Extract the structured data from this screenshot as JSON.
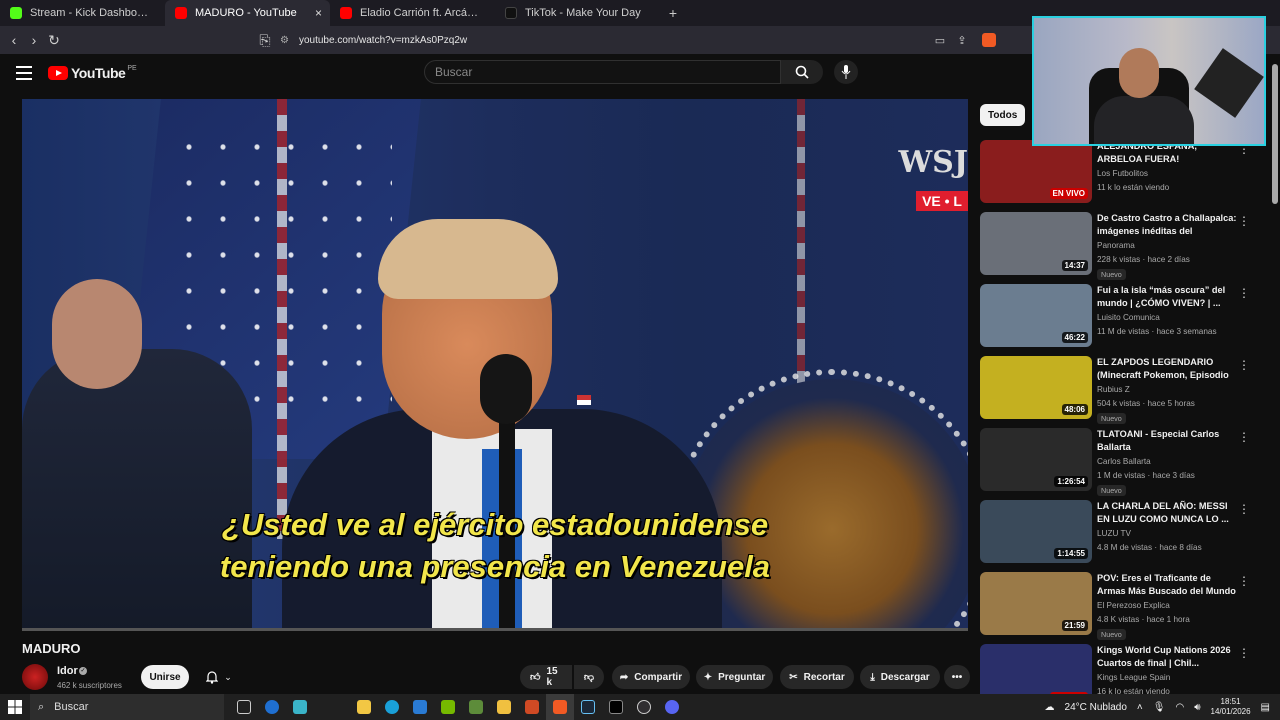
{
  "browser": {
    "tabs": [
      {
        "label": "Stream - Kick Dashboard",
        "favicon_color": "#53fc18"
      },
      {
        "label": "MADURO - YouTube",
        "favicon_color": "#ff0000",
        "close": "×"
      },
      {
        "label": "Eladio Carrión ft. Arcángel, De La Gh",
        "favicon_color": "#ff0000"
      },
      {
        "label": "TikTok - Make Your Day",
        "favicon_color": "#111111"
      }
    ],
    "new_tab": "+",
    "url": "youtube.com/watch?v=mzkAs0Pzq2w"
  },
  "youtube": {
    "logo": "YouTube",
    "country": "PE",
    "search_placeholder": "Buscar",
    "video": {
      "wsj": "WSJ",
      "live_tag": "VE • L",
      "subtitle_line1": "¿Usted ve al ejército estadounidense",
      "subtitle_line2": "teniendo una presencia en Venezuela",
      "title": "MADURO"
    },
    "channel": {
      "name": "Idor",
      "subs": "462 k suscriptores",
      "join": "Unirse"
    },
    "actions": {
      "likes": "15 k",
      "share": "Compartir",
      "ask": "Preguntar",
      "clip": "Recortar",
      "download": "Descargar"
    },
    "chips": {
      "all": "Todos"
    },
    "recommendations": [
      {
        "title": "ALEJANDRO ESPAÑA, ARBELOA FUERA!",
        "channel": "Los Futbolitos",
        "meta": "11 k lo están viendo",
        "badge": "EN VIVO",
        "thumb": "#8a1d1d",
        "new": ""
      },
      {
        "title": "De Castro Castro a Challapalca: imágenes inéditas del traslado...",
        "channel": "Panorama",
        "meta": "228 k vistas · hace 2 días",
        "badge": "14:37",
        "thumb": "#6a6f78",
        "new": "Nuevo"
      },
      {
        "title": "Fui a la isla “más oscura” del mundo | ¿CÓMO VIVEN? | ...",
        "channel": "Luisito Comunica",
        "meta": "11 M de vistas · hace 3 semanas",
        "badge": "46:22",
        "thumb": "#6b7d90",
        "new": ""
      },
      {
        "title": "EL ZAPDOS LEGENDARIO (Minecraft Pokemon, Episodio ...",
        "channel": "Rubius Z",
        "meta": "504 k vistas · hace 5 horas",
        "badge": "48:06",
        "thumb": "#c4b020",
        "new": "Nuevo"
      },
      {
        "title": "TLATOANI - Especial Carlos Ballarta",
        "channel": "Carlos Ballarta",
        "meta": "1 M de vistas · hace 3 días",
        "badge": "1:26:54",
        "thumb": "#2a2a2a",
        "new": "Nuevo"
      },
      {
        "title": "LA CHARLA DEL AÑO: MESSI EN LUZU COMO NUNCA LO ...",
        "channel": "LUZU TV",
        "meta": "4.8 M de vistas · hace 8 días",
        "badge": "1:14:55",
        "thumb": "#3a4a5a",
        "new": ""
      },
      {
        "title": "POV: Eres el Traficante de Armas Más Buscado del Mundo",
        "channel": "El Perezoso Explica",
        "meta": "4.8 K vistas · hace 1 hora",
        "badge": "21:59",
        "thumb": "#9a7a48",
        "new": "Nuevo"
      },
      {
        "title": "Kings World Cup Nations 2026 Cuartos de final | Chil...",
        "channel": "Kings League Spain",
        "meta": "16 k lo están viendo",
        "badge": "EN VIVO",
        "thumb": "#2a2f6a",
        "new": ""
      }
    ]
  },
  "taskbar": {
    "search": "Buscar",
    "weather": "24°C  Nublado",
    "time": "18:51",
    "date": "14/01/2026"
  }
}
